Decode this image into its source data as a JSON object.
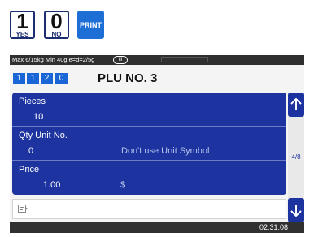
{
  "keys": {
    "yes": {
      "digit": "1",
      "label": "YES"
    },
    "no": {
      "digit": "0",
      "label": "NO"
    },
    "print": {
      "label": "PRINT"
    }
  },
  "status_bar": {
    "weight_info": "Max 6/15kg Min 40g e=d=2/5g",
    "accuracy_class": "III"
  },
  "header": {
    "plu_digits": [
      "1",
      "1",
      "2",
      "0"
    ],
    "title": "PLU NO. 3"
  },
  "fields": [
    {
      "label": "Pieces",
      "value": "10",
      "extra": ""
    },
    {
      "label": "Qty Unit No.",
      "value": "0",
      "extra": "Don't use Unit Symbol"
    },
    {
      "label": "Price",
      "value": "1.00",
      "extra": "$"
    }
  ],
  "pagination": {
    "indicator": "4/8",
    "up_icon": "arrow-up-icon",
    "down_icon": "arrow-down-icon"
  },
  "input": {
    "icon": "input-field-icon",
    "value": ""
  },
  "clock": "02:31:08",
  "colors": {
    "panel": "#1d34a0",
    "accent": "#1b66d6",
    "print_key": "#1d6fd6"
  }
}
